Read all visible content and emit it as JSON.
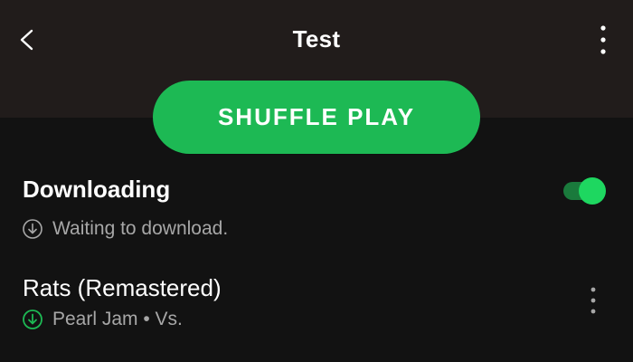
{
  "header": {
    "title": "Test",
    "back_icon": "chevron-left-icon",
    "more_icon": "more-vertical-icon"
  },
  "shuffle_button": {
    "label": "SHUFFLE PLAY",
    "color": "#1db954"
  },
  "download": {
    "label": "Downloading",
    "enabled": true,
    "status": "Waiting to download.",
    "status_icon": "download-circle-icon"
  },
  "track": {
    "title": "Rats (Remastered)",
    "subtitle": "Pearl Jam • Vs.",
    "downloaded_icon": "download-circle-icon",
    "downloaded_color": "#1db954",
    "more_icon": "more-vertical-icon"
  },
  "colors": {
    "background": "#121212",
    "header_bg": "#211c1b",
    "accent": "#1db954",
    "secondary_text": "#a7a7a7"
  }
}
